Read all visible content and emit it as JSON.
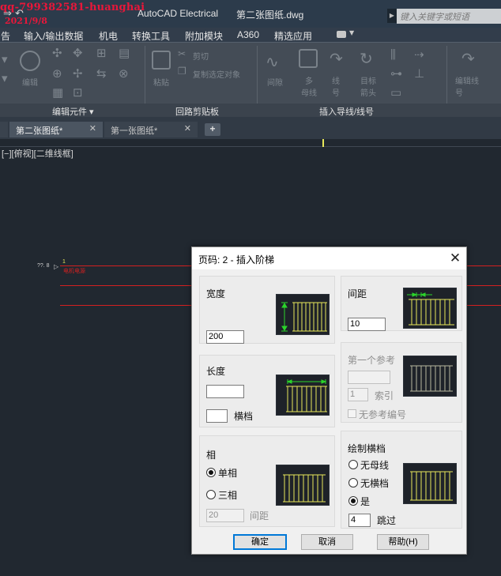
{
  "watermark": {
    "line1": "qq-799382581-huanghai",
    "line2": "2021/9/8"
  },
  "titlebar": {
    "app_name": "AutoCAD Electrical",
    "document_name": "第二张图纸.dwg",
    "search_placeholder": "键入关键字或短语"
  },
  "menu": {
    "items": [
      "告",
      "输入/输出数据",
      "机电",
      "转换工具",
      "附加模块",
      "A360",
      "精选应用"
    ]
  },
  "ribbon": {
    "panel_titles": [
      "编辑元件 ▾",
      "回路剪贴板",
      "插入导线/线号"
    ],
    "edit_label": "编辑",
    "paste_label": "粘贴",
    "cut_label": "剪切",
    "copy_label": "复制选定对象",
    "spacing_label": "间隙",
    "multi_bus_label": "多\n母线",
    "wire_label": "线\n号",
    "target_arrow_label": "目标\n箭头",
    "edit_wire_label": "编辑线\n号"
  },
  "tabs": {
    "items": [
      {
        "label": "第二张图纸*"
      },
      {
        "label": "第一张图纸*"
      }
    ],
    "close_glyph": "✕",
    "add_glyph": "+"
  },
  "viewport": {
    "label": "[−][俯视][二维线框]"
  },
  "canvas": {
    "ladder_ref": "??. 8",
    "rung_number": "1",
    "rung_text": "电机电源"
  },
  "dialog": {
    "title": "页码: 2 - 插入阶梯",
    "close_glyph": "✕",
    "width": {
      "label": "宽度",
      "value": "200"
    },
    "spacing": {
      "label": "间距",
      "value": "10"
    },
    "length": {
      "label": "长度",
      "value": "",
      "rungs_value": "",
      "rungs_label": "横档"
    },
    "first_reference": {
      "label": "第一个参考",
      "value": "",
      "index_value": "1",
      "index_label": "索引",
      "no_ref_label": "无参考编号",
      "no_ref_checked": false
    },
    "phase": {
      "label": "相",
      "single": "单相",
      "three": "三相",
      "selected": "单相",
      "spacing_value": "20",
      "spacing_label": "间距"
    },
    "draw_rungs": {
      "label": "绘制横档",
      "no_bus": "无母线",
      "no_rungs": "无横档",
      "yes": "是",
      "selected": "是",
      "skip_value": "4",
      "skip_label": "跳过"
    },
    "buttons": {
      "ok": "确定",
      "cancel": "取消",
      "help": "帮助(H)"
    }
  },
  "colors": {
    "canvas_bg": "#212830",
    "ladder_red": "#d42020",
    "preview_yellow": "#e8e85a",
    "dimension_green": "#2bd42b",
    "dialog_bg": "#f0f0f0",
    "default_button_border": "#0078d7"
  }
}
